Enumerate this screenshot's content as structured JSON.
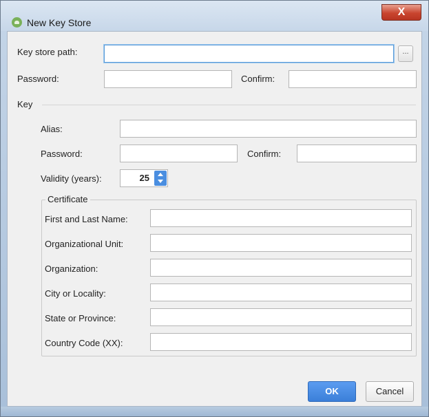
{
  "window": {
    "title": "New Key Store",
    "close_glyph": "X",
    "app_icon": "android-icon"
  },
  "keystore": {
    "path_label": "Key store path:",
    "path_value": "",
    "browse_label": "...",
    "password_label": "Password:",
    "password_value": "",
    "confirm_label": "Confirm:",
    "confirm_value": ""
  },
  "key": {
    "section_label": "Key",
    "alias_label": "Alias:",
    "alias_value": "",
    "password_label": "Password:",
    "password_value": "",
    "confirm_label": "Confirm:",
    "confirm_value": "",
    "validity_label": "Validity (years):",
    "validity_value": "25"
  },
  "certificate": {
    "section_label": "Certificate",
    "fields": [
      {
        "label": "First and Last Name:",
        "value": ""
      },
      {
        "label": "Organizational Unit:",
        "value": ""
      },
      {
        "label": "Organization:",
        "value": ""
      },
      {
        "label": "City or Locality:",
        "value": ""
      },
      {
        "label": "State or Province:",
        "value": ""
      },
      {
        "label": "Country Code (XX):",
        "value": ""
      }
    ]
  },
  "buttons": {
    "ok": "OK",
    "cancel": "Cancel"
  },
  "colors": {
    "ok_button": "#3b7fd9",
    "close_button": "#c9452f",
    "focus_border": "#5a9bd8"
  }
}
